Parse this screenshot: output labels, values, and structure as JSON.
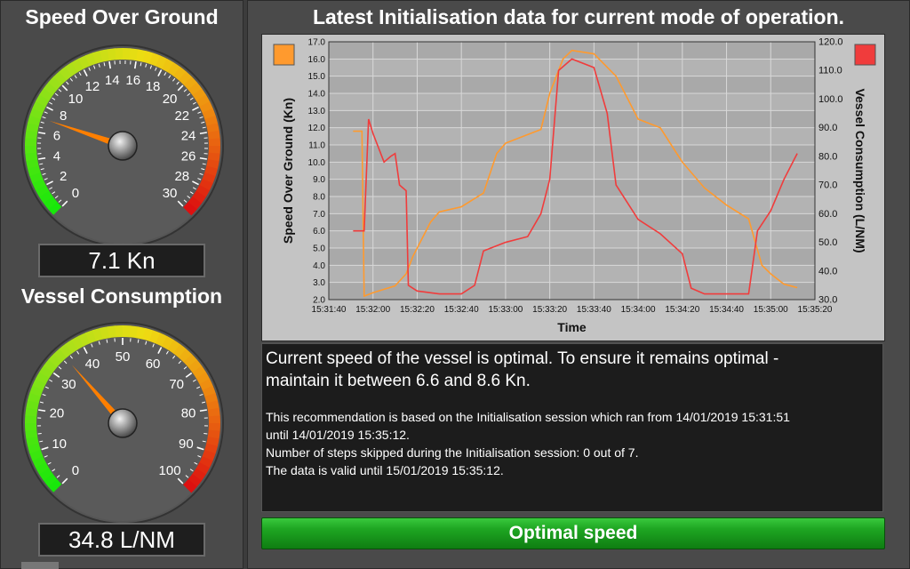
{
  "speed_gauge": {
    "title": "Speed Over Ground",
    "readout": "7.1 Kn",
    "value": 7.1,
    "min": 0,
    "max": 30,
    "tick_labels": [
      "0",
      "2",
      "4",
      "6",
      "8",
      "10",
      "12",
      "14",
      "16",
      "18",
      "20",
      "22",
      "24",
      "26",
      "28",
      "30"
    ]
  },
  "consumption_gauge": {
    "title": "Vessel Consumption",
    "readout": "34.8 L/NM",
    "value": 34.8,
    "min": 0,
    "max": 100,
    "tick_labels": [
      "0",
      "10",
      "20",
      "30",
      "40",
      "50",
      "60",
      "70",
      "80",
      "90",
      "100"
    ]
  },
  "main": {
    "title": "Latest Initialisation data for current mode of operation."
  },
  "recommendation": {
    "headline_line1": "Current speed of the vessel is optimal. To ensure it remains optimal -",
    "headline_line2": "maintain it between 6.6 and 8.6 Kn.",
    "detail_line1": "This recommendation is based on the Initialisation session which ran from 14/01/2019 15:31:51",
    "detail_line2": "until 14/01/2019 15:35:12.",
    "detail_line3": "Number of steps skipped during the Initialisation session: 0 out of 7.",
    "detail_line4": "The data is valid until 15/01/2019 15:35:12."
  },
  "status": {
    "label": "Optimal speed",
    "color": "#1ea622"
  },
  "colors": {
    "speed_series": "#ff9a2e",
    "consumption_series": "#f03c3c",
    "gauge_needle": "#ff7f00"
  },
  "chart_data": {
    "type": "line",
    "xlabel": "Time",
    "ylabel": "Speed Over Ground (Kn)",
    "y2label": "Vessel Consumption (L/NM)",
    "x_ticks": [
      "15:31:40",
      "15:32:00",
      "15:32:20",
      "15:32:40",
      "15:33:00",
      "15:33:20",
      "15:33:40",
      "15:34:00",
      "15:34:20",
      "15:34:40",
      "15:35:00",
      "15:35:20"
    ],
    "y_ticks": [
      "2.0",
      "3.0",
      "4.0",
      "5.0",
      "6.0",
      "7.0",
      "8.0",
      "9.0",
      "10.0",
      "11.0",
      "12.0",
      "13.0",
      "14.0",
      "15.0",
      "16.0",
      "17.0"
    ],
    "y2_ticks": [
      "30.0",
      "40.0",
      "50.0",
      "60.0",
      "70.0",
      "80.0",
      "90.0",
      "100.0",
      "110.0",
      "120.0"
    ],
    "ylim": [
      2,
      17
    ],
    "y2lim": [
      30,
      120
    ],
    "grid": true,
    "legend_placement": "top-left and top-right",
    "series": [
      {
        "axis": "left",
        "points": [
          [
            "15:31:51",
            11.8
          ],
          [
            "15:31:55",
            11.8
          ],
          [
            "15:31:56",
            2.2
          ],
          [
            "15:32:00",
            2.4
          ],
          [
            "15:32:05",
            2.6
          ],
          [
            "15:32:10",
            2.8
          ],
          [
            "15:32:15",
            3.5
          ],
          [
            "15:32:18",
            4.5
          ],
          [
            "15:32:22",
            5.5
          ],
          [
            "15:32:26",
            6.5
          ],
          [
            "15:32:30",
            7.1
          ],
          [
            "15:32:40",
            7.4
          ],
          [
            "15:32:50",
            8.2
          ],
          [
            "15:32:56",
            10.5
          ],
          [
            "15:33:00",
            11.1
          ],
          [
            "15:33:10",
            11.6
          ],
          [
            "15:33:16",
            11.9
          ],
          [
            "15:33:20",
            14.0
          ],
          [
            "15:33:26",
            16.0
          ],
          [
            "15:33:30",
            16.5
          ],
          [
            "15:33:40",
            16.3
          ],
          [
            "15:33:50",
            15.0
          ],
          [
            "15:34:00",
            12.5
          ],
          [
            "15:34:10",
            12.0
          ],
          [
            "15:34:20",
            10.0
          ],
          [
            "15:34:30",
            8.5
          ],
          [
            "15:34:40",
            7.5
          ],
          [
            "15:34:50",
            6.7
          ],
          [
            "15:34:56",
            4.0
          ],
          [
            "15:35:00",
            3.5
          ],
          [
            "15:35:06",
            2.9
          ],
          [
            "15:35:12",
            2.7
          ]
        ]
      },
      {
        "axis": "right",
        "points": [
          [
            "15:31:51",
            54
          ],
          [
            "15:31:56",
            54
          ],
          [
            "15:31:58",
            93
          ],
          [
            "15:32:00",
            88
          ],
          [
            "15:32:05",
            78
          ],
          [
            "15:32:08",
            80
          ],
          [
            "15:32:10",
            81
          ],
          [
            "15:32:12",
            70
          ],
          [
            "15:32:15",
            68
          ],
          [
            "15:32:16",
            35
          ],
          [
            "15:32:20",
            33
          ],
          [
            "15:32:30",
            32
          ],
          [
            "15:32:40",
            32
          ],
          [
            "15:32:46",
            35
          ],
          [
            "15:32:50",
            47
          ],
          [
            "15:33:00",
            50
          ],
          [
            "15:33:10",
            52
          ],
          [
            "15:33:16",
            60
          ],
          [
            "15:33:20",
            72
          ],
          [
            "15:33:24",
            110
          ],
          [
            "15:33:30",
            114
          ],
          [
            "15:33:40",
            111
          ],
          [
            "15:33:46",
            95
          ],
          [
            "15:33:50",
            70
          ],
          [
            "15:34:00",
            58
          ],
          [
            "15:34:10",
            53
          ],
          [
            "15:34:20",
            46
          ],
          [
            "15:34:24",
            34
          ],
          [
            "15:34:30",
            32
          ],
          [
            "15:34:40",
            32
          ],
          [
            "15:34:50",
            32
          ],
          [
            "15:34:54",
            54
          ],
          [
            "15:35:00",
            61
          ],
          [
            "15:35:06",
            72
          ],
          [
            "15:35:12",
            81
          ]
        ]
      }
    ]
  }
}
